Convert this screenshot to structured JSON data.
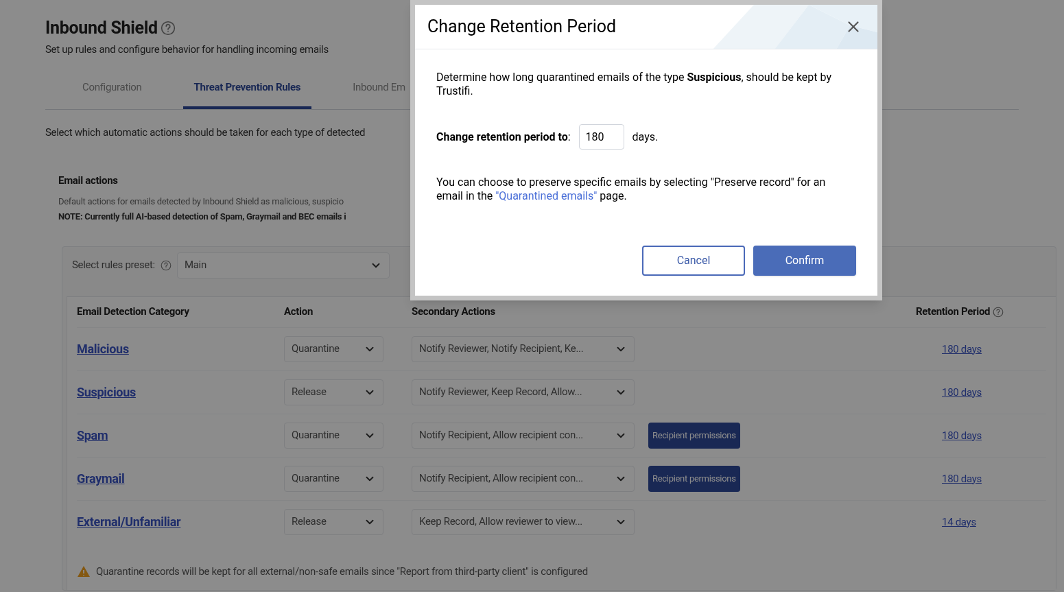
{
  "page": {
    "title": "Inbound Shield",
    "subtitle": "Set up rules and configure behavior for handling incoming emails"
  },
  "tabs": [
    {
      "label": "Configuration",
      "selected": false
    },
    {
      "label": "Threat Prevention Rules",
      "selected": true
    },
    {
      "label": "Inbound Em",
      "selected": false
    }
  ],
  "intro": "Select which automatic actions should be taken for each type of detected",
  "section": {
    "title": "Email actions",
    "description": "Default actions for emails detected by Inbound Shield as malicious, suspicio",
    "note": "NOTE: Currently full AI-based detection of Spam, Graymail and BEC emails i"
  },
  "preset": {
    "label": "Select rules preset:",
    "value": "Main"
  },
  "table": {
    "columns": [
      "Email Detection Category",
      "Action",
      "Secondary Actions",
      "Retention Period"
    ],
    "rows": [
      {
        "category": "Malicious",
        "action": "Quarantine",
        "secondary": "Notify Reviewer, Notify Recipient, Ke...",
        "retention": "180 days"
      },
      {
        "category": "Suspicious",
        "action": "Release",
        "secondary": "Notify Reviewer, Keep Record, Allow...",
        "retention": "180 days"
      },
      {
        "category": "Spam",
        "action": "Quarantine",
        "secondary": "Notify Recipient, Allow recipient con...",
        "permissions": "Recipient permissions",
        "retention": "180 days"
      },
      {
        "category": "Graymail",
        "action": "Quarantine",
        "secondary": "Notify Recipient, Allow recipient con...",
        "permissions": "Recipient permissions",
        "retention": "180 days"
      },
      {
        "category": "External/Unfamiliar",
        "action": "Release",
        "secondary": "Keep Record, Allow reviewer to view...",
        "retention": "14 days"
      }
    ]
  },
  "warning": "Quarantine records will be kept for all external/non-safe emails since \"Report from third-party client\" is configured",
  "dialog": {
    "title": "Change Retention Period",
    "description": "Determine how long quarantined emails of the type **Suspicious**, should be kept by Trustifi.",
    "field_label": "**Change retention period to**:",
    "field_value": "180",
    "unit": "days.",
    "hint_before": "You can choose to preserve specific emails by selecting \"Preserve record\" for an email in the",
    "hint_link": "\"Quarantined emails\"",
    "hint_after": "page.",
    "buttons": {
      "cancel": "Cancel",
      "confirm": "Confirm"
    }
  }
}
